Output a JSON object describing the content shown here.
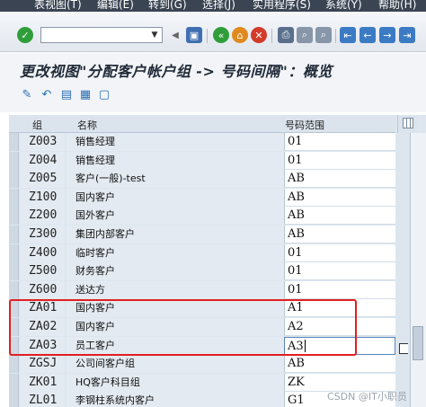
{
  "menu": {
    "items": [
      "表视图(T)",
      "编辑(E)",
      "转到(G)",
      "选择(J)",
      "实用程序(S)",
      "系统(Y)",
      "帮助(H)"
    ]
  },
  "toolbar": {
    "command_value": "",
    "icons": [
      "enter-icon",
      "save-icon",
      "back-icon",
      "exit-icon",
      "cancel-icon",
      "print-icon",
      "find-icon",
      "find-next-icon",
      "first-page-icon",
      "previous-page-icon",
      "next-page-icon",
      "last-page-icon"
    ]
  },
  "title": "更改视图\"分配客户帐户组 -> 号码间隔\"：概览",
  "app_toolbar": {
    "icons": [
      "display-change-icon",
      "undo-icon",
      "select-all-icon",
      "select-block-icon",
      "deselect-all-icon"
    ]
  },
  "table": {
    "columns": [
      "组",
      "名称",
      "号码范围"
    ],
    "rows": [
      {
        "group": "Z003",
        "name": "销售经理",
        "range": "01"
      },
      {
        "group": "Z004",
        "name": "销售经理",
        "range": "01"
      },
      {
        "group": "Z005",
        "name": "客户(一般)-test",
        "range": "AB"
      },
      {
        "group": "Z100",
        "name": "国内客户",
        "range": "AB"
      },
      {
        "group": "Z200",
        "name": "国外客户",
        "range": "AB"
      },
      {
        "group": "Z300",
        "name": "集团内部客户",
        "range": "AB"
      },
      {
        "group": "Z400",
        "name": "临时客户",
        "range": "01"
      },
      {
        "group": "Z500",
        "name": "财务客户",
        "range": "01"
      },
      {
        "group": "Z600",
        "name": "送达方",
        "range": "01"
      },
      {
        "group": "ZA01",
        "name": "国内客户",
        "range": "A1"
      },
      {
        "group": "ZA02",
        "name": "国内客户",
        "range": "A2"
      },
      {
        "group": "ZA03",
        "name": "员工客户",
        "range": "A3"
      },
      {
        "group": "ZGSJ",
        "name": "公司间客户组",
        "range": "AB"
      },
      {
        "group": "ZK01",
        "name": "HQ客户科目组",
        "range": "ZK"
      },
      {
        "group": "ZL01",
        "name": "李钢柱系统内客户",
        "range": "G1"
      }
    ]
  },
  "watermark": "CSDN @IT小职员",
  "colors": {
    "menubar": "#3a4452",
    "highlight": "#e02020",
    "table_bg": "#dde6ef"
  }
}
